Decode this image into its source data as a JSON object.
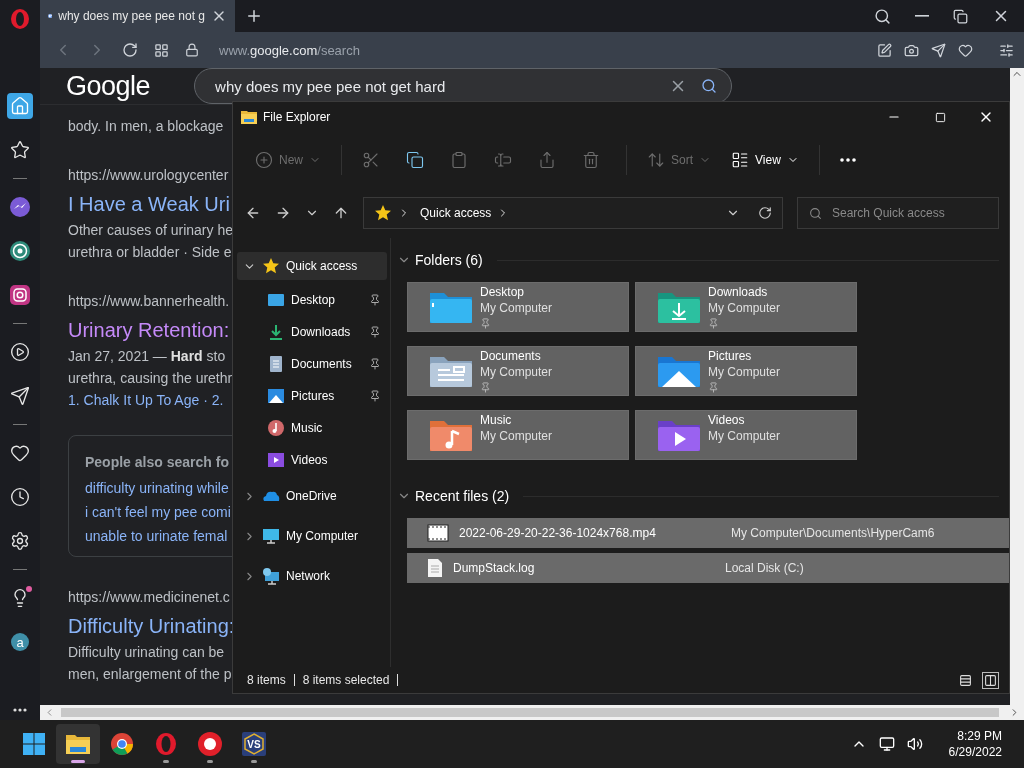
{
  "browser": {
    "tabs": [
      {
        "title": "why does my pee pee not g",
        "selected": true
      }
    ],
    "address": {
      "prefix": "www.",
      "domain": "google.com",
      "path": "/search"
    },
    "sidebar": [
      [
        {
          "kind": "home",
          "selected": true,
          "notify": false
        },
        {
          "kind": "star",
          "selected": false,
          "notify": false
        }
      ],
      [
        {
          "kind": "messenger",
          "selected": false,
          "notify": false
        },
        {
          "kind": "whatsapp",
          "selected": false,
          "notify": false
        },
        {
          "kind": "instagram",
          "selected": false,
          "notify": false
        }
      ],
      [
        {
          "kind": "player",
          "selected": false,
          "notify": false
        },
        {
          "kind": "send",
          "selected": false,
          "notify": false
        }
      ],
      [
        {
          "kind": "heart",
          "selected": false,
          "notify": false
        },
        {
          "kind": "history",
          "selected": false,
          "notify": false
        },
        {
          "kind": "settings",
          "selected": false,
          "notify": false
        }
      ],
      [
        {
          "kind": "tips",
          "selected": false,
          "notify": true
        },
        {
          "kind": "aria",
          "label": "a",
          "selected": false,
          "notify": false
        }
      ]
    ],
    "page": {
      "logo": "Google",
      "query": "why does my pee pee not get hard",
      "results": [
        {
          "kind": "result",
          "lines": [
            "body. In men, a blockage"
          ]
        },
        {
          "kind": "result",
          "url": "https://www.urologycenter",
          "title": "I Have a Weak Uri",
          "visited": false,
          "lines": [
            "Other causes of urinary he",
            "urethra or bladder · Side e"
          ]
        },
        {
          "kind": "result",
          "url": "https://www.bannerhealth.",
          "title": "Urinary Retention:",
          "visited": true,
          "lines": [
            "Jan 27, 2021 — **Hard** sto",
            "urethra, causing the urethr"
          ],
          "links": "1. Chalk It Up To Age · 2."
        },
        {
          "kind": "related",
          "heading": "People also search fo",
          "queries": [
            "difficulty urinating while",
            "i can't feel my pee comi",
            "unable to urinate femal"
          ]
        },
        {
          "kind": "result",
          "url": "https://www.medicinenet.c",
          "title": "Difficulty Urinating:",
          "visited": false,
          "lines": [
            "Difficulty urinating can be",
            "men, enlargement of the p"
          ]
        }
      ]
    }
  },
  "explorer": {
    "title": "File Explorer",
    "toolbar": [
      {
        "kind": "new",
        "label": "New",
        "disabled": true
      },
      {
        "kind": "cut",
        "disabled": true
      },
      {
        "kind": "copy",
        "disabled": false
      },
      {
        "kind": "paste",
        "disabled": true
      },
      {
        "kind": "rename",
        "disabled": true
      },
      {
        "kind": "share",
        "disabled": true
      },
      {
        "kind": "delete",
        "disabled": true
      },
      {
        "kind": "sort",
        "label": "Sort",
        "disabled": true
      },
      {
        "kind": "view",
        "label": "View",
        "disabled": false
      },
      {
        "kind": "more",
        "disabled": false
      }
    ],
    "path": "Quick access",
    "search_placeholder": "Search Quick access",
    "tree": [
      {
        "kind": "quick",
        "label": "Quick access",
        "expanded": true,
        "selected": true,
        "children": [
          {
            "kind": "desktop",
            "label": "Desktop",
            "pinned": true,
            "selected": false
          },
          {
            "kind": "downloads",
            "label": "Downloads",
            "pinned": true,
            "selected": false
          },
          {
            "kind": "documents",
            "label": "Documents",
            "pinned": true,
            "selected": false
          },
          {
            "kind": "pictures",
            "label": "Pictures",
            "pinned": true,
            "selected": false
          },
          {
            "kind": "music",
            "label": "Music",
            "pinned": false,
            "selected": false
          },
          {
            "kind": "videos",
            "label": "Videos",
            "pinned": false,
            "selected": false
          }
        ]
      },
      {
        "kind": "onedrive",
        "label": "OneDrive",
        "expanded": false,
        "selected": false
      },
      {
        "kind": "computer",
        "label": "My Computer",
        "expanded": false,
        "selected": false
      },
      {
        "kind": "network",
        "label": "Network",
        "expanded": false,
        "selected": false
      }
    ],
    "sections": [
      {
        "heading": "Folders (6)",
        "kind": "tiles",
        "expanded": true,
        "items": [
          {
            "kind": "desktop",
            "name": "Desktop",
            "location": "My Computer",
            "pinned": true,
            "selected": true
          },
          {
            "kind": "downloads",
            "name": "Downloads",
            "location": "My Computer",
            "pinned": true,
            "selected": true
          },
          {
            "kind": "documents",
            "name": "Documents",
            "location": "My Computer",
            "pinned": true,
            "selected": true
          },
          {
            "kind": "pictures",
            "name": "Pictures",
            "location": "My Computer",
            "pinned": true,
            "selected": true
          },
          {
            "kind": "music",
            "name": "Music",
            "location": "My Computer",
            "pinned": false,
            "selected": true
          },
          {
            "kind": "videos",
            "name": "Videos",
            "location": "My Computer",
            "pinned": false,
            "selected": true
          }
        ]
      },
      {
        "heading": "Recent files (2)",
        "kind": "list",
        "expanded": true,
        "items": [
          {
            "kind": "video",
            "name": "2022-06-29-20-22-36-1024x768.mp4",
            "location": "My Computer\\Documents\\HyperCam6",
            "selected": true
          },
          {
            "kind": "text",
            "name": "DumpStack.log",
            "location": "Local Disk (C:)",
            "selected": true
          }
        ]
      }
    ],
    "status": {
      "count": "8 items",
      "selection": "8 items selected"
    },
    "views": [
      {
        "kind": "details",
        "selected": false
      },
      {
        "kind": "tiles",
        "selected": true
      }
    ]
  },
  "taskbar": {
    "apps": [
      {
        "kind": "start",
        "running": false,
        "active": false
      },
      {
        "kind": "explorer",
        "running": true,
        "active": true
      },
      {
        "kind": "chrome",
        "running": false,
        "active": false
      },
      {
        "kind": "opera",
        "running": true,
        "active": false
      },
      {
        "kind": "recorder",
        "running": true,
        "active": false
      },
      {
        "kind": "vs",
        "label": "VS",
        "running": true,
        "active": false
      }
    ],
    "time": "8:29 PM",
    "date": "6/29/2022"
  }
}
